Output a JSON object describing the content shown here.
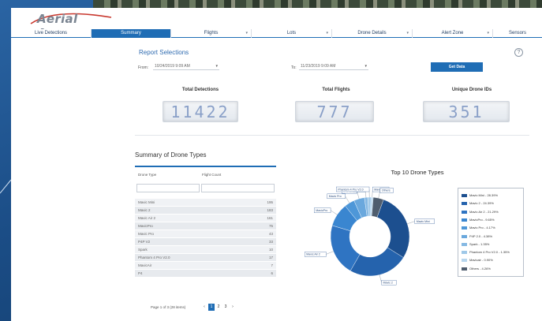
{
  "app": {
    "logo_text": "Aerial Armor"
  },
  "nav": {
    "tabs": [
      {
        "label": "Live Detections",
        "active": false,
        "dropdown": false
      },
      {
        "label": "Summary",
        "active": true,
        "dropdown": false
      },
      {
        "label": "Flights",
        "active": false,
        "dropdown": true
      },
      {
        "label": "Lots",
        "active": false,
        "dropdown": true
      },
      {
        "label": "Drone Details",
        "active": false,
        "dropdown": true
      },
      {
        "label": "Alert Zone",
        "active": false,
        "dropdown": true
      },
      {
        "label": "Sensors",
        "active": false,
        "dropdown": false
      }
    ]
  },
  "report": {
    "title": "Report Selections",
    "from_label": "From:",
    "from_value": "10/24/2019 9:09 AM",
    "to_label": "To:",
    "to_value": "11/23/2019 9:09 AM",
    "get_data_label": "Get Data"
  },
  "stats": {
    "total_detections_label": "Total Detections",
    "total_detections_value": "11422",
    "total_flights_label": "Total Flights",
    "total_flights_value": "777",
    "unique_drone_ids_label": "Unique Drone IDs",
    "unique_drone_ids_value": "351"
  },
  "summary": {
    "title": "Summary of Drone Types",
    "col_type": "Drone Type",
    "col_count": "Flight Count",
    "rows": [
      {
        "type": "Mavic Mini",
        "count": "195"
      },
      {
        "type": "Mavic 2",
        "count": "183"
      },
      {
        "type": "Mavic Air 2",
        "count": "161"
      },
      {
        "type": "MavicPro",
        "count": "75"
      },
      {
        "type": "Mavic Pro",
        "count": "43"
      },
      {
        "type": "P4P V2",
        "count": "33"
      },
      {
        "type": "Spark",
        "count": "10"
      },
      {
        "type": "Phantom 4 Pro V2.0",
        "count": "17"
      },
      {
        "type": "MavicAir",
        "count": "7"
      },
      {
        "type": "P4",
        "count": "6"
      }
    ],
    "pager_text": "Page 1 of 3 (28 items)",
    "pages": [
      "1",
      "2",
      "3"
    ],
    "current_page": "1"
  },
  "chart_data": {
    "type": "pie",
    "title": "Top 10 Drone Types",
    "donut": true,
    "categories": [
      "Mavic Mini",
      "Mavic 2",
      "Mavic Air 2",
      "MavicPro",
      "Mavic Pro",
      "P4P 2.0",
      "Spark",
      "Phantom 4 Pro V2.0",
      "MavicAir",
      "Others"
    ],
    "values": [
      28.39,
      24.39,
      21.29,
      9.65,
      4.17,
      4.38,
      1.35,
      1.35,
      0.9,
      4.26
    ],
    "legend_labels": [
      "Mavic Mini - 28.39%",
      "Mavic 2 - 24.39%",
      "Mavic Air 2 - 21.29%",
      "MavicPro - 9.65%",
      "Mavic Pro - 4.17%",
      "P4P 2.0 - 4.38%",
      "Spark - 1.35%",
      "Phantom 4 Pro V2.0 - 1.35%",
      "Mavicair - 0.90%",
      "Others - 4.26%"
    ],
    "colors": [
      "#1c4f8f",
      "#2563ad",
      "#2f74c2",
      "#3a86d0",
      "#4e97d8",
      "#6aa8dd",
      "#86b9e3",
      "#9fc8e8",
      "#b7d6ee",
      "#4f5d6e"
    ],
    "legend": "right"
  }
}
